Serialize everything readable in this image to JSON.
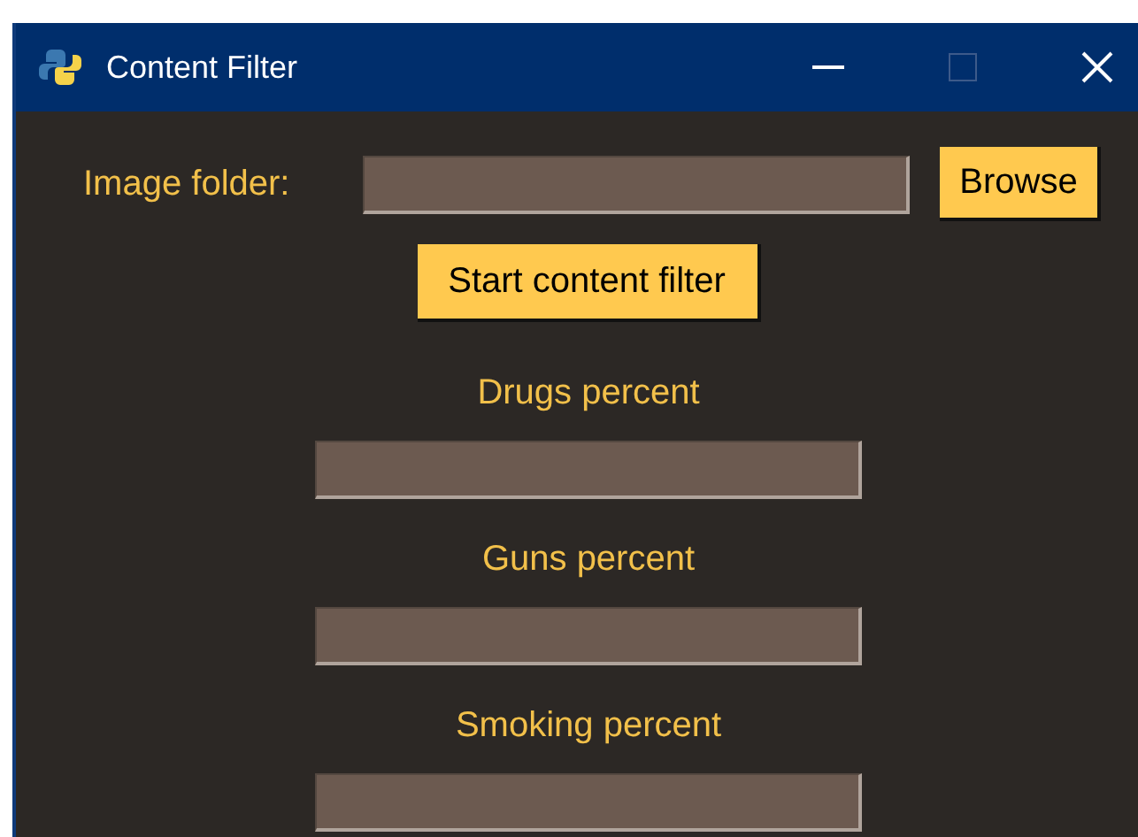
{
  "window": {
    "title": "Content Filter"
  },
  "folder": {
    "label": "Image folder:",
    "button": "Browse"
  },
  "start_button": "Start content filter",
  "percent_fields": [
    {
      "label": "Drugs percent"
    },
    {
      "label": "Guns percent"
    },
    {
      "label": "Smoking percent"
    }
  ]
}
